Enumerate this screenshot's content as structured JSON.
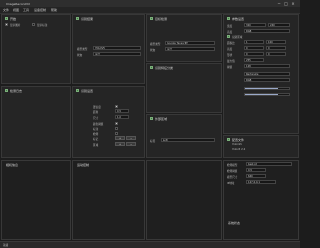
{
  "app": {
    "title": "ImageReconCtrl"
  },
  "menu": {
    "items": [
      "文件",
      "视图",
      "工具",
      "设备控制",
      "帮助"
    ]
  },
  "panels": {
    "a": {
      "header": "开始",
      "cb1": "显示图片",
      "cb2": "显示标注"
    },
    "b": {
      "header": "识别结果"
    },
    "c": {
      "header": "检测日志"
    },
    "d": {
      "header": "识别设置",
      "row1": "置信度",
      "row2": "距离",
      "row3": "尺寸",
      "row4": "颜色阈值",
      "row5": "标注",
      "row6": "检测",
      "row7": "标记",
      "row8": "区域"
    },
    "e": {
      "header": "目标检测",
      "field_label": "模型类型",
      "field_value": "Google TensorRT",
      "sub_label": "状态",
      "sub_value": "运行"
    },
    "f": {
      "header": "识别特征分类"
    },
    "g": {
      "header": "外部区域",
      "sub_label": "标签",
      "sub_value": "标签"
    },
    "h": {
      "header": "参数设置",
      "rows": [
        "宽度",
        "高度",
        "识别区域",
        "面积比",
        "亮度",
        "形状",
        "最大值",
        "阈值"
      ]
    },
    "i": {
      "header": "配置文件",
      "name": "Yoloinfo",
      "ver": "Yolov5 2.2",
      "r1": "检测模型",
      "r2": "检测阈值",
      "r3": "模型尺寸",
      "ip_label": "IP地址",
      "ip": "127.0.0.1"
    },
    "j": {
      "header": "运动控制",
      "sub": "区域"
    },
    "k": {
      "header": "相机信息"
    },
    "l": {
      "header": "系统状态"
    }
  },
  "progress": {
    "level": 0.75
  },
  "status": {
    "text": "就绪"
  }
}
